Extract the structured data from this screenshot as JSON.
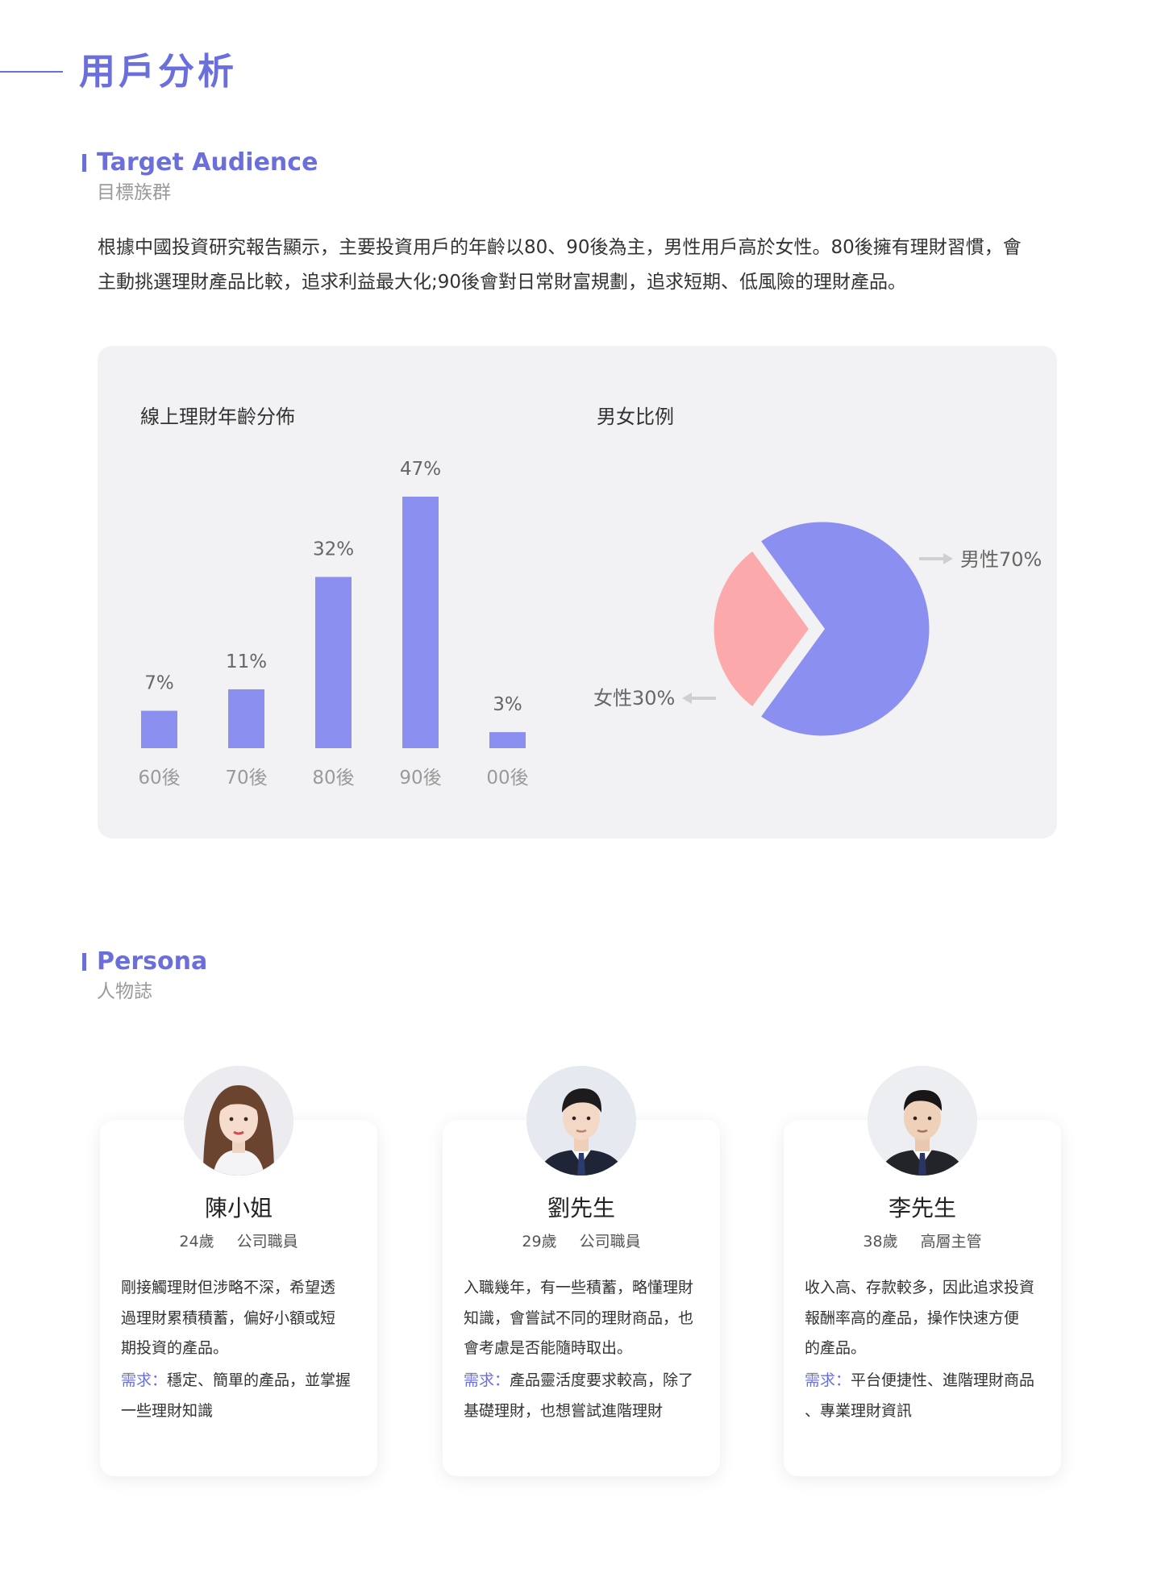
{
  "page": {
    "title": "用戶分析"
  },
  "target_audience": {
    "heading_en": "Target Audience",
    "heading_zh": "目標族群",
    "description_line1": "根據中國投資研究報告顯示，主要投資用戶的年齡以80、90後為主，男性用戶高於女性。80後擁有理財習慣，會",
    "description_line2": "主動挑選理財產品比較，追求利益最大化;90後會對日常財富規劃，追求短期、低風險的理財產品。"
  },
  "chart_data": [
    {
      "type": "bar",
      "title": "線上理財年齡分佈",
      "categories": [
        "60後",
        "70後",
        "80後",
        "90後",
        "00後"
      ],
      "values": [
        7,
        11,
        32,
        47,
        3
      ],
      "value_labels": [
        "7%",
        "11%",
        "32%",
        "47%",
        "3%"
      ],
      "ylim": [
        0,
        47
      ],
      "grid": false,
      "color": "#8b8ff0"
    },
    {
      "type": "pie",
      "title": "男女比例",
      "slices": [
        {
          "label": "男性70%",
          "value": 70,
          "color": "#8b8ff0"
        },
        {
          "label": "女性30%",
          "value": 30,
          "color": "#fba9ab"
        }
      ]
    }
  ],
  "persona": {
    "heading_en": "Persona",
    "heading_zh": "人物誌",
    "need_label": "需求：",
    "cards": [
      {
        "name": "陳小姐",
        "age": "24歲",
        "job": "公司職員",
        "desc": [
          "剛接觸理財但涉略不深，希望透",
          "過理財累積積蓄，偏好小額或短",
          "期投資的產品。"
        ],
        "need": [
          "穩定、簡單的產品，並掌握",
          "一些理財知識"
        ],
        "avatar_icon": "female-avatar-icon"
      },
      {
        "name": "劉先生",
        "age": "29歲",
        "job": "公司職員",
        "desc": [
          "入職幾年，有一些積蓄，略懂理財",
          "知識，會嘗試不同的理財商品，也",
          "會考慮是否能隨時取出。"
        ],
        "need": [
          "產品靈活度要求較高，除了",
          "基礎理財，也想嘗試進階理財"
        ],
        "avatar_icon": "male-avatar-icon"
      },
      {
        "name": "李先生",
        "age": "38歲",
        "job": "高層主管",
        "desc": [
          "收入高、存款較多，因此追求投資",
          "報酬率高的產品，操作快速方便",
          "的產品。"
        ],
        "need": [
          "平台便捷性、進階理財商品",
          "、專業理財資訊"
        ],
        "avatar_icon": "male-avatar-icon"
      }
    ]
  },
  "colors": {
    "accent": "#6b6fdc",
    "bar": "#8b8ff0",
    "female": "#fba9ab",
    "panel": "#f2f2f4"
  }
}
